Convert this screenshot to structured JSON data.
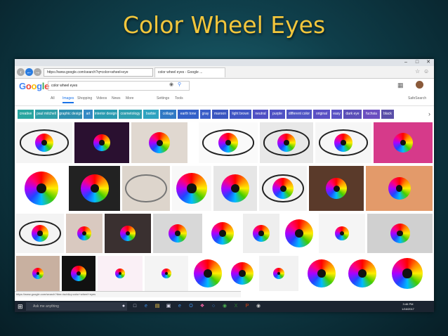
{
  "slide": {
    "title": "Color Wheel Eyes"
  },
  "browser": {
    "url": "https://www.google.com/search?q=color+wheel+eye",
    "tab_title": "color wheel eyes - Google ..."
  },
  "google": {
    "logo": "Google",
    "query": "color wheel eyes",
    "tabs": [
      "All",
      "Images",
      "Shopping",
      "Videos",
      "News",
      "More",
      "Settings",
      "Tools"
    ],
    "safesearch": "SafeSearch"
  },
  "chips": [
    "creative",
    "paul mitchell",
    "graphic design",
    "art",
    "interior design",
    "cosmetology",
    "barbie",
    "collage",
    "earth tone",
    "gray",
    "maroon",
    "light brown",
    "neutral",
    "purple",
    "different color",
    "original",
    "easy",
    "dark eye",
    "fuchsia",
    "black"
  ],
  "status_url": "https://www.google.com/search?tbm=isch&q=color+wheel+eyes",
  "taskbar": {
    "search_placeholder": "Ask me anything",
    "time": "3:46 PM",
    "date": "1/16/2017"
  },
  "colors": {
    "slide_title": "#f2c63c",
    "chip_colors": [
      "#2aa6a0",
      "#2e9fa8",
      "#2f8fb0",
      "#3489c4",
      "#2a9bb0",
      "#2e9fb0",
      "#2fa3c0",
      "#3079c4",
      "#3361c8",
      "#3a5ec8",
      "#3a56c0",
      "#3f55c4",
      "#4f4fc4",
      "#4f52c4",
      "#4f55c4",
      "#5a50c4",
      "#5a52c4",
      "#5b4fb8",
      "#6b4fc0",
      "#5a4fa8"
    ]
  }
}
